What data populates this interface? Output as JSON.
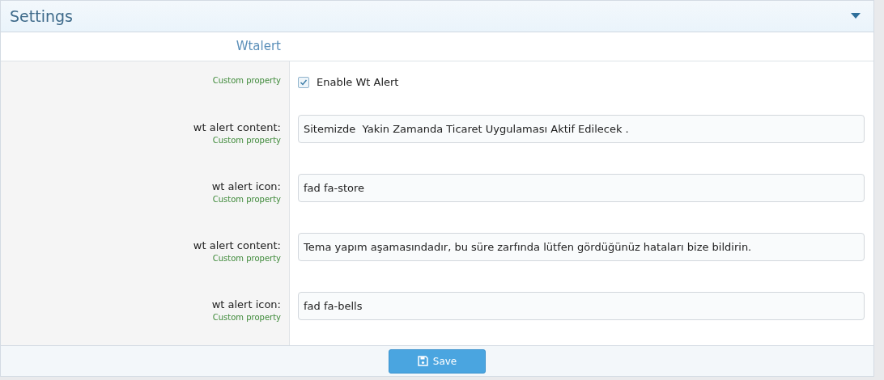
{
  "panel": {
    "title": "Settings",
    "expanded": true
  },
  "section": {
    "title": "Wtalert"
  },
  "rows": [
    {
      "kind": "checkbox",
      "label": "",
      "hint": "Custom property",
      "text": "Enable Wt Alert",
      "checked": true
    },
    {
      "kind": "text",
      "label": "wt alert content:",
      "hint": "Custom property",
      "value": "Sitemizde  Yakin Zamanda Ticaret Uygulaması Aktif Edilecek ."
    },
    {
      "kind": "text",
      "label": "wt alert icon:",
      "hint": "Custom property",
      "value": "fad fa-store"
    },
    {
      "kind": "text",
      "label": "wt alert content:",
      "hint": "Custom property",
      "value": "Tema yapım aşamasındadır, bu süre zarfında lütfen gördüğünüz hataları bize bildirin."
    },
    {
      "kind": "text",
      "label": "wt alert icon:",
      "hint": "Custom property",
      "value": "fad fa-bells"
    }
  ],
  "save_button": {
    "label": "Save"
  }
}
